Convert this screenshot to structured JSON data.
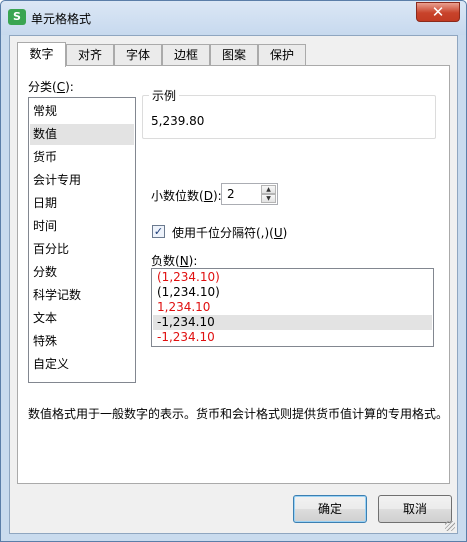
{
  "window": {
    "title": "单元格格式",
    "app_icon": "S",
    "close_glyph": "✕"
  },
  "tabs": [
    {
      "label": "数字",
      "active": true
    },
    {
      "label": "对齐"
    },
    {
      "label": "字体"
    },
    {
      "label": "边框"
    },
    {
      "label": "图案"
    },
    {
      "label": "保护"
    }
  ],
  "category": {
    "label_prefix": "分类(",
    "label_key": "C",
    "label_suffix": "):",
    "items": [
      "常规",
      "数值",
      "货币",
      "会计专用",
      "日期",
      "时间",
      "百分比",
      "分数",
      "科学记数",
      "文本",
      "特殊",
      "自定义"
    ],
    "selected": "数值"
  },
  "sample": {
    "title": "示例",
    "value": "5,239.80"
  },
  "decimal": {
    "label_prefix": "小数位数(",
    "label_key": "D",
    "label_suffix": "):",
    "value": "2"
  },
  "thousands": {
    "label_prefix": "使用千位分隔符(,)(",
    "label_key": "U",
    "label_suffix": ")",
    "checked": true,
    "check_glyph": "✓"
  },
  "negative": {
    "label_prefix": "负数(",
    "label_key": "N",
    "label_suffix": "):",
    "items": [
      {
        "text": "(1,234.10)",
        "color": "#e01010"
      },
      {
        "text": "(1,234.10)",
        "color": "#000000"
      },
      {
        "text": "1,234.10",
        "color": "#e01010"
      },
      {
        "text": "-1,234.10",
        "color": "#000000",
        "selected": true
      },
      {
        "text": "-1,234.10",
        "color": "#e01010"
      }
    ]
  },
  "description": "数值格式用于一般数字的表示。货币和会计格式则提供货币值计算的专用格式。",
  "buttons": {
    "ok": "确定",
    "cancel": "取消"
  },
  "spin": {
    "up_glyph": "▲",
    "down_glyph": "▼"
  }
}
